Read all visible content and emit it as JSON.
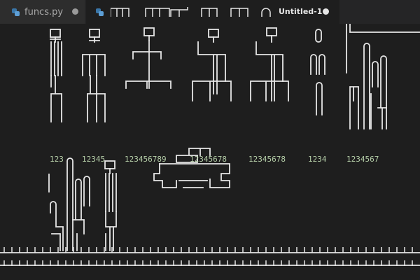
{
  "tabs": [
    {
      "label": "funcs.py",
      "active": false,
      "icon": "python-icon",
      "status": "modified-dot"
    },
    {
      "label": "Untitled-1",
      "active": true,
      "icon": "python-icon",
      "status": "modified-dot"
    }
  ],
  "editor": {
    "labels": [
      "123",
      "12345",
      "123456789",
      "12345678",
      "12345678",
      "1234",
      "1234567"
    ]
  },
  "colors": {
    "editor_bg": "#1e1e1e",
    "tabbar_bg": "#252526",
    "number_green": "#b5cea8",
    "line_white": "#e6e6e6"
  }
}
